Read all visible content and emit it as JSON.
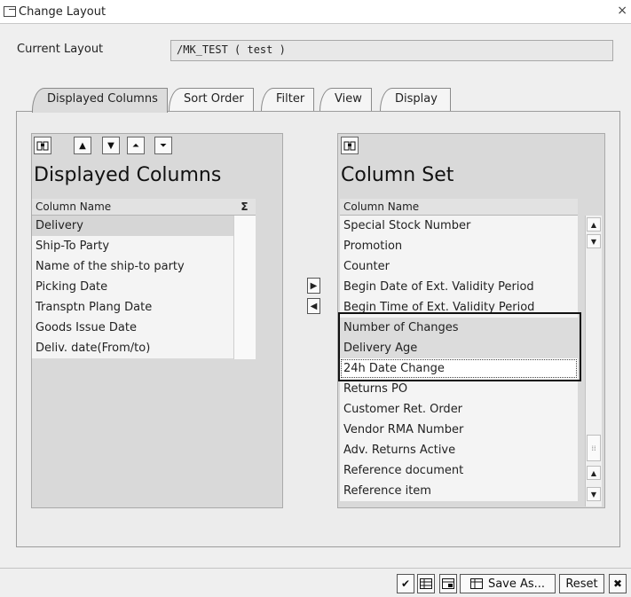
{
  "window": {
    "title": "Change Layout",
    "close_glyph": "×"
  },
  "current_layout": {
    "label": "Current Layout",
    "value": "/MK_TEST ( test )"
  },
  "tabs": [
    {
      "label": "Displayed Columns",
      "active": true
    },
    {
      "label": "Sort Order",
      "active": false
    },
    {
      "label": "Filter",
      "active": false
    },
    {
      "label": "View",
      "active": false
    },
    {
      "label": "Display",
      "active": false
    }
  ],
  "displayed_columns": {
    "title": "Displayed Columns",
    "column_header": "Column Name",
    "sum_icon": "Σ",
    "toolbar_icons": [
      "find-icon",
      "move-up-icon",
      "move-down-icon",
      "move-top-icon",
      "move-bottom-icon"
    ],
    "rows": [
      {
        "label": "Delivery",
        "selected": true
      },
      {
        "label": "Ship-To Party",
        "selected": false
      },
      {
        "label": "Name of the ship-to party",
        "selected": false
      },
      {
        "label": "Picking Date",
        "selected": false
      },
      {
        "label": "Transptn Plang Date",
        "selected": false
      },
      {
        "label": "Goods Issue Date",
        "selected": false
      },
      {
        "label": "Deliv. date(From/to)",
        "selected": false
      }
    ]
  },
  "column_set": {
    "title": "Column Set",
    "column_header": "Column Name",
    "rows": [
      {
        "label": "Special Stock Number",
        "selected": false
      },
      {
        "label": "Promotion",
        "selected": false
      },
      {
        "label": "Counter",
        "selected": false
      },
      {
        "label": "Begin Date of Ext. Validity Period",
        "selected": false
      },
      {
        "label": "Begin Time of Ext. Validity Period",
        "selected": false
      },
      {
        "label": "Number of  Changes",
        "selected": true
      },
      {
        "label": "Delivery Age",
        "selected": true
      },
      {
        "label": "24h Date Change",
        "selected": true,
        "focused": true
      },
      {
        "label": "Returns PO",
        "selected": false
      },
      {
        "label": "Customer Ret. Order",
        "selected": false
      },
      {
        "label": "Vendor RMA Number",
        "selected": false
      },
      {
        "label": "Adv. Returns Active",
        "selected": false
      },
      {
        "label": "Reference document",
        "selected": false
      },
      {
        "label": "Reference item",
        "selected": false
      }
    ]
  },
  "footer": {
    "save_as_label": "Save As...",
    "reset_label": "Reset"
  }
}
